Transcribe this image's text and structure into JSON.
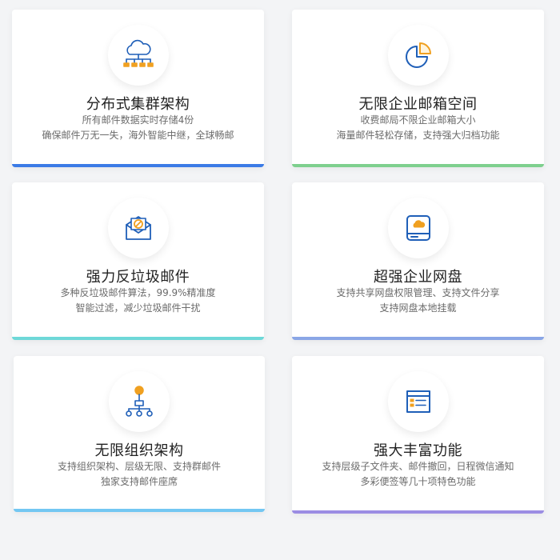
{
  "features": [
    {
      "title": "分布式集群架构",
      "lines": [
        "所有邮件数据实时存储4份",
        "确保邮件万无一失，海外智能中继，全球畅邮"
      ],
      "icon": "cloud-network-icon",
      "accent": "#3b7be6"
    },
    {
      "title": "无限企业邮箱空间",
      "lines": [
        "收费邮局不限企业邮箱大小",
        "海量邮件轻松存储，支持强大归档功能"
      ],
      "icon": "pie-chart-icon",
      "accent": "#7ed08e"
    },
    {
      "title": "强力反垃圾邮件",
      "lines": [
        "多种反垃圾邮件算法，99.9%精准度",
        "智能过滤，减少垃圾邮件干扰"
      ],
      "icon": "blocked-mail-icon",
      "accent": "#6ed8d8"
    },
    {
      "title": "超强企业网盘",
      "lines": [
        "支持共享网盘权限管理、支持文件分享",
        "支持网盘本地挂载"
      ],
      "icon": "cloud-drive-icon",
      "accent": "#8aa6e6"
    },
    {
      "title": "无限组织架构",
      "lines": [
        "支持组织架构、层级无限、支持群邮件",
        "独家支持邮件座席"
      ],
      "icon": "org-chart-icon",
      "accent": "#73c7f2"
    },
    {
      "title": "强大丰富功能",
      "lines": [
        "支持层级子文件夹、邮件撤回，日程微信通知",
        "多彩便签等几十项特色功能"
      ],
      "icon": "browser-window-icon",
      "accent": "#9b8de3"
    }
  ]
}
